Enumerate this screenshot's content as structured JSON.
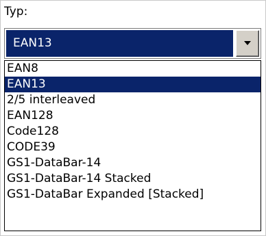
{
  "field": {
    "label": "Typ:"
  },
  "combo": {
    "selected": "EAN13",
    "dropdown_icon": "chevron-down-icon"
  },
  "list": {
    "selected_index": 1,
    "items": [
      {
        "label": "EAN8"
      },
      {
        "label": "EAN13"
      },
      {
        "label": "2/5 interleaved"
      },
      {
        "label": "EAN128"
      },
      {
        "label": "Code128"
      },
      {
        "label": "CODE39"
      },
      {
        "label": "GS1-DataBar-14"
      },
      {
        "label": "GS1-DataBar-14 Stacked"
      },
      {
        "label": "GS1-DataBar Expanded [Stacked]"
      }
    ]
  },
  "colors": {
    "selection_bg": "#0a246a",
    "selection_fg": "#ffffff",
    "button_face": "#d4d0c8"
  }
}
